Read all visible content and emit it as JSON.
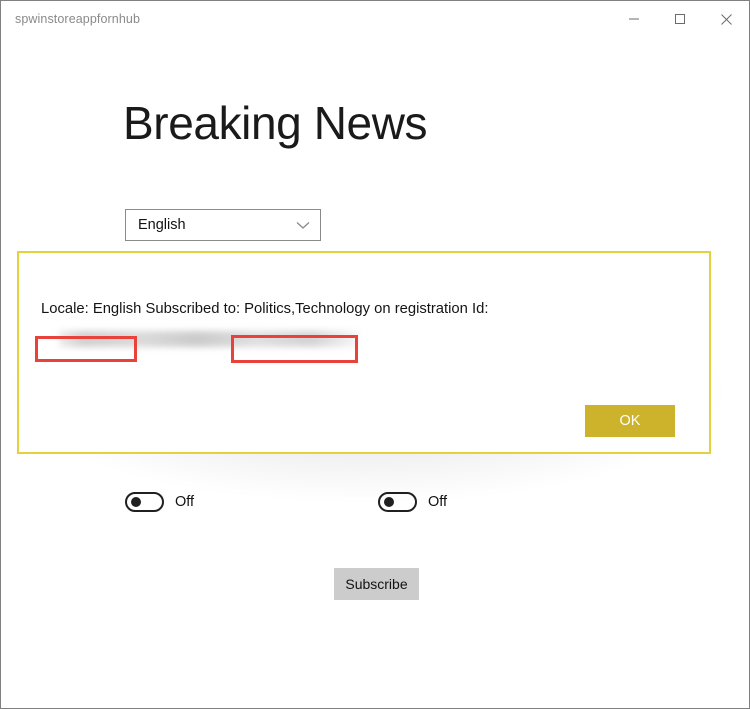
{
  "window": {
    "title": "spwinstoreappfornhub",
    "caption_buttons": [
      {
        "name": "minimize",
        "icon": "minimize-icon"
      },
      {
        "name": "maximize",
        "icon": "maximize-icon"
      },
      {
        "name": "close",
        "icon": "close-icon"
      }
    ]
  },
  "page": {
    "heading": "Breaking News"
  },
  "locale_select": {
    "value": "English",
    "icon": "chevron-down-icon",
    "options": [
      "English"
    ]
  },
  "toggles": [
    {
      "label": "Off",
      "state": "off"
    },
    {
      "label": "Off",
      "state": "off"
    }
  ],
  "subscribe": {
    "label": "Subscribe"
  },
  "dialog": {
    "message_part1": "Locale: English",
    "message_part2": " Subscribed to: ",
    "message_part3": "Politics,Technology",
    "message_part4": " on registration Id:",
    "registration_id": "",
    "ok_label": "OK",
    "border_color": "#e3d13f",
    "ok_color": "#ccb32b"
  },
  "annotations": [
    {
      "label": "locale-highlight",
      "color": "#e8423a"
    },
    {
      "label": "topics-highlight",
      "color": "#e8423a"
    }
  ]
}
